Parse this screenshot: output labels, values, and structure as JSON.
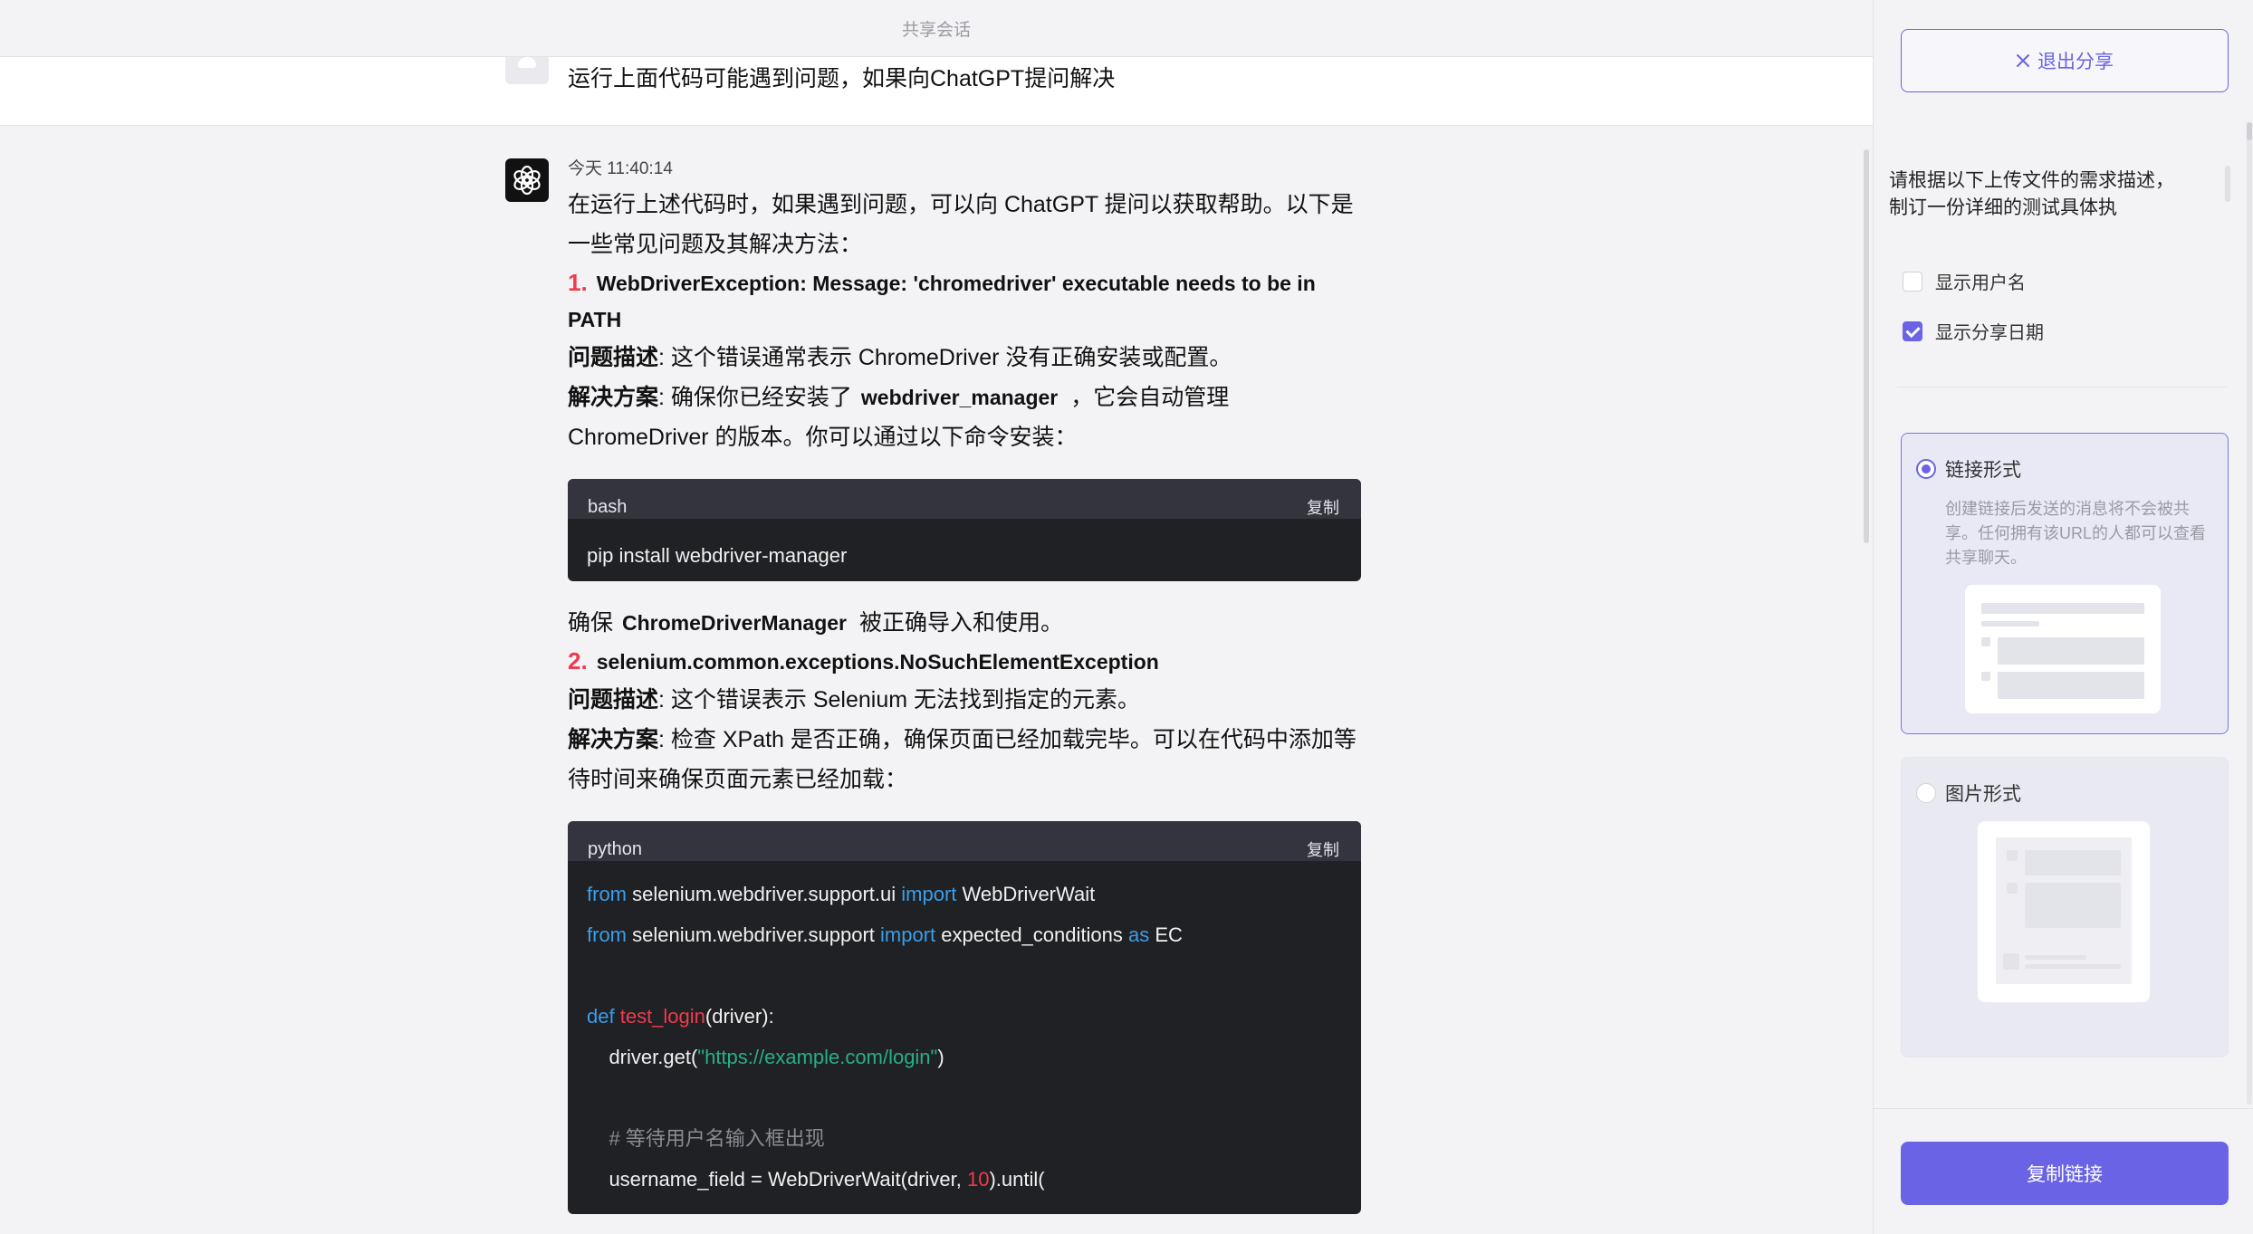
{
  "header": {
    "title": "共享会话"
  },
  "user_message": {
    "text": "运行上面代码可能遇到问题，如果向ChatGPT提问解决"
  },
  "bot_message": {
    "timestamp": "今天 11:40:14",
    "intro": "在运行上述代码时，如果遇到问题，可以向 ChatGPT 提问以获取帮助。以下是一些常见问题及其解决方法：",
    "item1": {
      "num": "1.",
      "title": "WebDriverException: Message: 'chromedriver' executable needs to be in PATH",
      "desc_label": "问题描述",
      "desc_text": ": 这个错误通常表示 ChromeDriver 没有正确安装或配置。",
      "sol_label": "解决方案",
      "sol_text1": ": 确保你已经安装了",
      "sol_code": "webdriver_manager",
      "sol_text2": "，它会自动管理 ChromeDriver 的版本。你可以通过以下命令安装："
    },
    "code1": {
      "lang": "bash",
      "copy_label": "复制",
      "code": "pip install webdriver-manager"
    },
    "after1": {
      "prefix": "确保",
      "code": "ChromeDriverManager",
      "suffix": "被正确导入和使用。"
    },
    "item2": {
      "num": "2.",
      "title": "selenium.common.exceptions.NoSuchElementException",
      "desc_label": "问题描述",
      "desc_text": ": 这个错误表示 Selenium 无法找到指定的元素。",
      "sol_label": "解决方案",
      "sol_text": ": 检查 XPath 是否正确，确保页面已经加载完毕。可以在代码中添加等待时间来确保页面元素已经加载："
    },
    "code2": {
      "lang": "python",
      "copy_label": "复制",
      "lines": {
        "l1": {
          "k1": "from",
          "t1": " selenium.webdriver.support.ui ",
          "k2": "import",
          "t2": " WebDriverWait"
        },
        "l2": {
          "k1": "from",
          "t1": " selenium.webdriver.support ",
          "k2": "import",
          "t2": " expected_conditions ",
          "k3": "as",
          "t3": " EC"
        },
        "l4": {
          "k1": "def",
          "fn": "test_login",
          "t1": "(driver):"
        },
        "l5": {
          "t1": "    driver.get(",
          "s1": "\"https://example.com/login\"",
          "t2": ")"
        },
        "l7": {
          "c1": "    # 等待用户名输入框出现"
        },
        "l8": {
          "t1": "    username_field = WebDriverWait(driver, ",
          "n1": "10",
          "t2": ").until("
        }
      }
    }
  },
  "panel": {
    "exit_label": "退出分享",
    "description": "请根据以下上传文件的需求描述，制订一份详细的测试具体执",
    "options": {
      "show_username": {
        "label": "显示用户名",
        "checked": false
      },
      "show_date": {
        "label": "显示分享日期",
        "checked": true
      }
    },
    "link_mode": {
      "label": "链接形式",
      "desc": "创建链接后发送的消息将不会被共享。任何拥有该URL的人都可以查看共享聊天。",
      "selected": true
    },
    "image_mode": {
      "label": "图片形式",
      "selected": false
    },
    "copy_link_label": "复制链接"
  },
  "colors": {
    "accent": "#6a63e6",
    "code_bg": "#202124",
    "keyword": "#3b9ee8",
    "string": "#27b086",
    "function": "#ef3b4e"
  }
}
